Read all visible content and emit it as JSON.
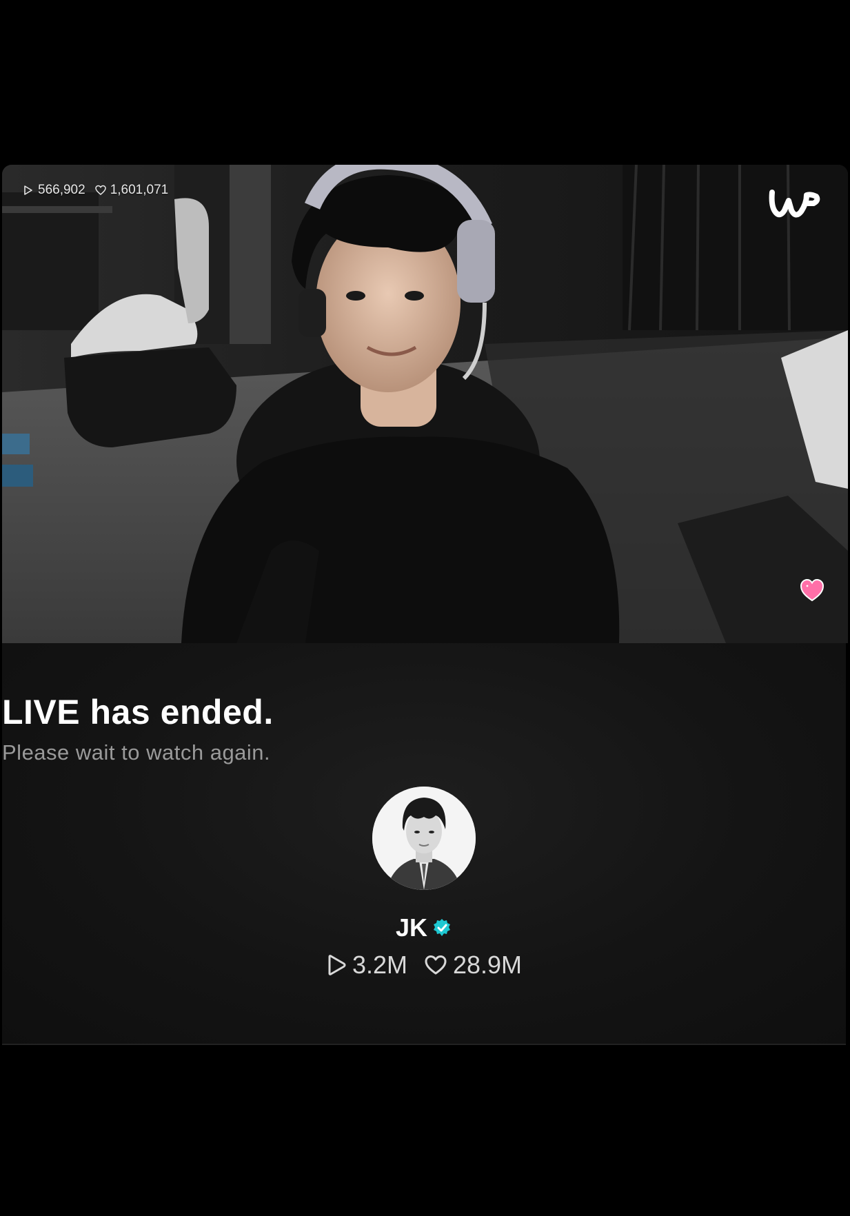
{
  "video": {
    "plays": "566,902",
    "likes": "1,601,071",
    "logo_icon": "weverse-w-logo-icon",
    "floating_icon": "pink-heart-icon"
  },
  "ended": {
    "title": "LIVE has ended.",
    "subtitle": "Please wait to watch again."
  },
  "artist": {
    "name": "JK",
    "verified_icon": "verified-badge-icon",
    "total_plays": "3.2M",
    "total_likes": "28.9M"
  },
  "colors": {
    "verified": "#1ec8d2",
    "heart": "#ff6fa8",
    "background": "#000000"
  }
}
